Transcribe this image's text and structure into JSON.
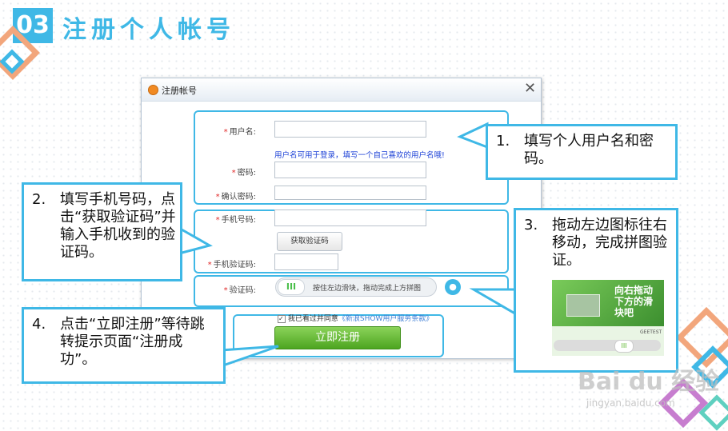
{
  "header": {
    "badge": "03",
    "title": "注册个人帐号"
  },
  "dialog": {
    "title": "注册帐号",
    "close": "✕",
    "username": {
      "label": "用户名:",
      "hint": "用户名可用于登录，填写一个自己喜欢的用户名哦!"
    },
    "password": {
      "label": "密码:"
    },
    "confirm_password": {
      "label": "确认密码:"
    },
    "phone": {
      "label": "手机号码:"
    },
    "get_code_button": "获取验证码",
    "sms_code": {
      "label": "手机验证码:"
    },
    "captcha": {
      "label": "验证码:",
      "knob": "III",
      "slider_text": "按住左边滑块，拖动完成上方拼图"
    },
    "agreement": {
      "text": "我已看过并同意",
      "link": "《新浪SHOW用户服务条款》"
    },
    "register_button": "立即注册"
  },
  "callouts": {
    "step1": {
      "num": "1.",
      "text": "填写个人用户名和密码。"
    },
    "step2": {
      "num": "2.",
      "text": "填写手机号码，点击“获取验证码”并输入手机收到的验证码。"
    },
    "step3": {
      "num": "3.",
      "text": "拖动左边图标往右移动，完成拼图验证。"
    },
    "step4": {
      "num": "4.",
      "text": "点击“立即注册”等待跳转提示页面“注册成功”。"
    }
  },
  "puzzle": {
    "text": "向右拖动下方的滑块吧",
    "brand": "GEETEST"
  },
  "watermark": {
    "logo": "Bai du 经验",
    "url": "jingyan.baidu.com"
  },
  "colors": {
    "accent": "#3fb8e6",
    "button_green": "#5cb82d",
    "required": "#e12b2b"
  }
}
